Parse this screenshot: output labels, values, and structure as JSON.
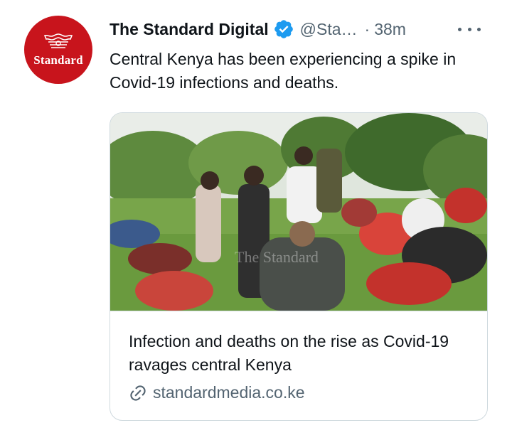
{
  "tweet": {
    "author": {
      "avatar_wordmark": "Standard",
      "display_name": "The Standard Digital",
      "handle": "@Sta…",
      "separator": "·",
      "timestamp": "38m",
      "verified": true
    },
    "text": "Central Kenya has been experiencing a spike in Covid-19 infections and deaths.",
    "more_icon": "more-horizontal-icon",
    "card": {
      "title": "Infection and deaths on the rise as Covid-19 ravages central Kenya",
      "domain": "standardmedia.co.ke",
      "link_icon": "link-icon",
      "watermark": "The Standard"
    }
  },
  "colors": {
    "brand_red": "#c8141c",
    "verified_blue": "#1d9bf0",
    "text_primary": "#0f1419",
    "text_secondary": "#536471",
    "border": "#cfd9de"
  }
}
